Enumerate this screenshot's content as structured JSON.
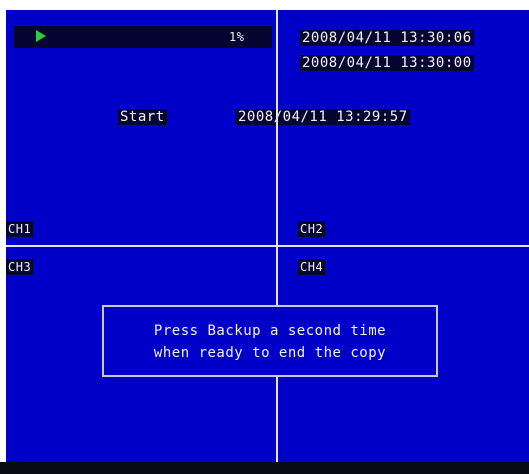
{
  "status": {
    "progress_text": "1%",
    "current_time": "2008/04/11 13:30:06",
    "end_time": "2008/04/11 13:30:00"
  },
  "backup": {
    "start_label": "Start",
    "start_time": "2008/04/11 13:29:57"
  },
  "channels": {
    "ch1": "CH1",
    "ch2": "CH2",
    "ch3": "CH3",
    "ch4": "CH4"
  },
  "dialog": {
    "line1": "Press Backup a second time",
    "line2": "when ready to end the copy"
  },
  "icons": {
    "playback": "play-icon"
  },
  "colors": {
    "background": "#0000c8",
    "bar": "#050532",
    "play_icon": "#2ecc40",
    "text": "#f2f2f2"
  }
}
